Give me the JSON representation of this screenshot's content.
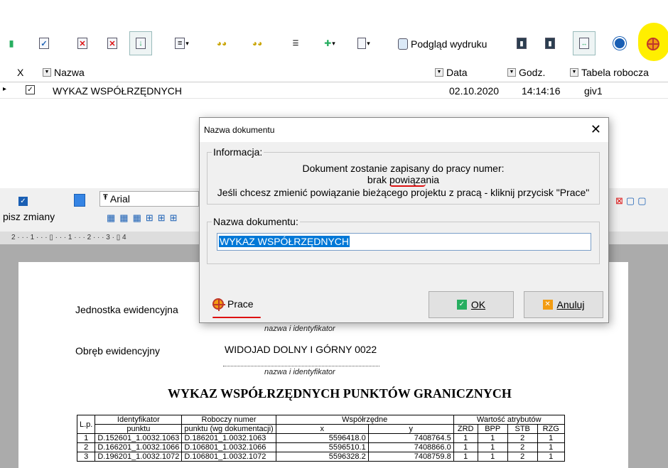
{
  "toolbar": {
    "print_preview_label": "Podgląd wydruku"
  },
  "grid": {
    "headers": {
      "x": "X",
      "name": "Nazwa",
      "date": "Data",
      "time": "Godz.",
      "table": "Tabela robocza"
    },
    "row": {
      "checked": "✓",
      "name": "WYKAZ WSPÓŁRZĘDNYCH",
      "date": "02.10.2020",
      "time": "14:14:16",
      "table": "giv1"
    }
  },
  "editor": {
    "save_changes_partial": "pisz zmiany",
    "font_name": "Arial",
    "ruler_text": "2 · · · 1 · · · ▯ · · · 1 · · · 2 · · · 3 · ▯ 4"
  },
  "document": {
    "unit_label": "Jednostka ewidencyjna",
    "unit_caption": "nazwa i identyfikator",
    "precinct_label": "Obręb ewidencyjny",
    "precinct_value": "WIDOJAD DOLNY I GÓRNY 0022",
    "precinct_caption": "nazwa i identyfikator",
    "title": "WYKAZ WSPÓŁRZĘDNYCH PUNKTÓW GRANICZNYCH",
    "table": {
      "h_lp": "L.p.",
      "h_id1": "Identyfikator",
      "h_id2": "punktu",
      "h_work1": "Roboczy numer",
      "h_work2": "punktu (wg dokumentacji)",
      "h_coords": "Współrzędne",
      "h_x": "x",
      "h_y": "y",
      "h_attrs": "Wartość atrybutów",
      "h_zrd": "ZRD",
      "h_bpp": "BPP",
      "h_stb": "STB",
      "h_rzg": "RZG",
      "rows": [
        {
          "lp": "1",
          "id": "D.152601_1.0032.1063",
          "work": "D.186201_1.0032.1063",
          "x": "5596418.0",
          "y": "7408764.5",
          "zrd": "1",
          "bpp": "1",
          "stb": "2",
          "rzg": "1"
        },
        {
          "lp": "2",
          "id": "D.166201_1.0032.1066",
          "work": "D.106801_1.0032.1066",
          "x": "5596510.1",
          "y": "7408866.0",
          "zrd": "1",
          "bpp": "1",
          "stb": "2",
          "rzg": "1"
        },
        {
          "lp": "3",
          "id": "D.196201_1.0032.1072",
          "work": "D.106801_1.0032.1072",
          "x": "5596328.2",
          "y": "7408759.8",
          "zrd": "1",
          "bpp": "1",
          "stb": "2",
          "rzg": "1"
        }
      ]
    }
  },
  "dialog": {
    "title": "Nazwa dokumentu",
    "close": "✕",
    "info_group": "Informacja:",
    "info_line1": "Dokument zostanie zapisany do pracy numer:",
    "info_line2_a": "brak ",
    "info_line2_b": "powiąza",
    "info_line2_c": "nia",
    "info_line3": "Jeśli chcesz zmienić powiązanie bieżącego projektu z pracą - kliknij przycisk \"Prace\"",
    "name_group": "Nazwa dokumentu:",
    "name_value": "WYKAZ WSPÓŁRZĘDNYCH",
    "prace_label": "Prace",
    "ok_label": "OK",
    "cancel_label": "Anuluj"
  }
}
